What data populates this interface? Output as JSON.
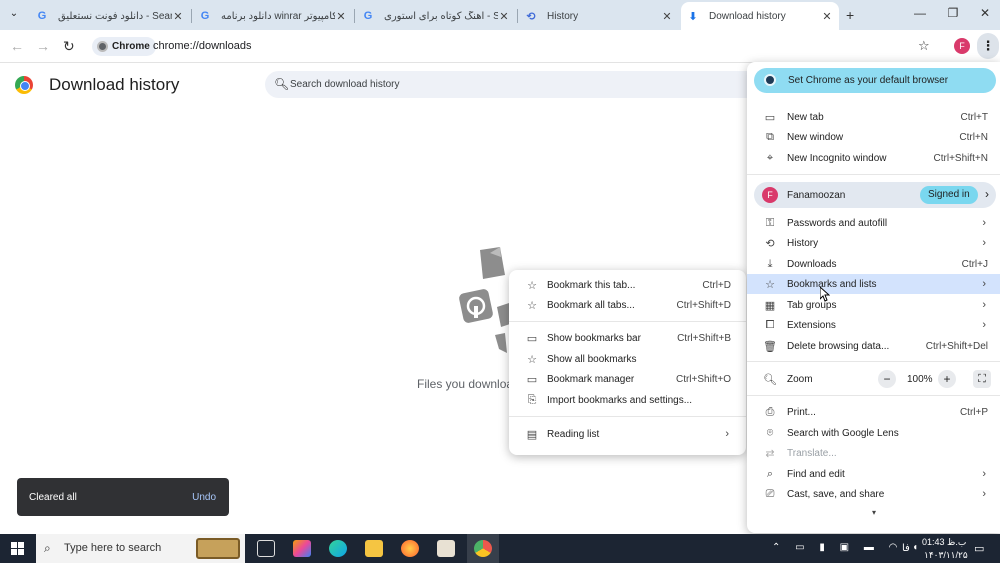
{
  "tabs": [
    {
      "title": "دانلود فونت نستعلیق - Search",
      "icon": "google-icon",
      "active": false
    },
    {
      "title": "دانلود برنامه winrar کامپیوتر -",
      "icon": "google-icon",
      "active": false
    },
    {
      "title": "آهنگ کوتاه برای استوری - Search",
      "icon": "google-icon",
      "active": false
    },
    {
      "title": "History",
      "icon": "history-icon",
      "active": false
    },
    {
      "title": "Download history",
      "icon": "download-icon",
      "active": true
    }
  ],
  "toolbar": {
    "site_chip": "Chrome",
    "url": "chrome://downloads",
    "profile_initial": "F"
  },
  "page": {
    "title": "Download history",
    "search_placeholder": "Search download history",
    "empty_text": "Files you download appear here"
  },
  "toast": {
    "message": "Cleared all",
    "action": "Undo"
  },
  "main_menu": {
    "banner": "Set Chrome as your default browser",
    "group1": [
      {
        "label": "New tab",
        "shortcut": "Ctrl+T",
        "icon": "new-tab-icon"
      },
      {
        "label": "New window",
        "shortcut": "Ctrl+N",
        "icon": "new-window-icon"
      },
      {
        "label": "New Incognito window",
        "shortcut": "Ctrl+Shift+N",
        "icon": "incognito-icon"
      }
    ],
    "profile": {
      "name": "Fanamoozan",
      "initial": "F",
      "status": "Signed in"
    },
    "group2": [
      {
        "label": "Passwords and autofill",
        "shortcut": "",
        "arrow": true,
        "icon": "key-icon"
      },
      {
        "label": "History",
        "shortcut": "",
        "arrow": true,
        "icon": "history-icon"
      },
      {
        "label": "Downloads",
        "shortcut": "Ctrl+J",
        "arrow": false,
        "icon": "download-icon"
      },
      {
        "label": "Bookmarks and lists",
        "shortcut": "",
        "arrow": true,
        "icon": "star-icon"
      },
      {
        "label": "Tab groups",
        "shortcut": "",
        "arrow": true,
        "icon": "tab-groups-icon"
      },
      {
        "label": "Extensions",
        "shortcut": "",
        "arrow": true,
        "icon": "puzzle-icon"
      },
      {
        "label": "Delete browsing data...",
        "shortcut": "Ctrl+Shift+Del",
        "arrow": false,
        "icon": "trash-icon"
      }
    ],
    "zoom": {
      "label": "Zoom",
      "minus": "−",
      "value": "100%",
      "plus": "+"
    },
    "group3": [
      {
        "label": "Print...",
        "shortcut": "Ctrl+P",
        "arrow": false,
        "icon": "print-icon",
        "disabled": false
      },
      {
        "label": "Search with Google Lens",
        "shortcut": "",
        "arrow": false,
        "icon": "lens-icon",
        "disabled": false
      },
      {
        "label": "Translate...",
        "shortcut": "",
        "arrow": false,
        "icon": "translate-icon",
        "disabled": true
      },
      {
        "label": "Find and edit",
        "shortcut": "",
        "arrow": true,
        "icon": "find-icon",
        "disabled": false
      },
      {
        "label": "Cast, save, and share",
        "shortcut": "",
        "arrow": true,
        "icon": "cast-icon",
        "disabled": false
      }
    ]
  },
  "submenu": {
    "group1": [
      {
        "label": "Bookmark this tab...",
        "shortcut": "Ctrl+D",
        "icon": "star-icon"
      },
      {
        "label": "Bookmark all tabs...",
        "shortcut": "Ctrl+Shift+D",
        "icon": "star-icon"
      }
    ],
    "group2": [
      {
        "label": "Show bookmarks bar",
        "shortcut": "Ctrl+Shift+B",
        "icon": "bookmarks-bar-icon"
      },
      {
        "label": "Show all bookmarks",
        "shortcut": "",
        "icon": "star-icon"
      },
      {
        "label": "Bookmark manager",
        "shortcut": "Ctrl+Shift+O",
        "icon": "bookmark-manager-icon"
      },
      {
        "label": "Import bookmarks and settings...",
        "shortcut": "",
        "icon": "import-icon"
      }
    ],
    "group3": [
      {
        "label": "Reading list",
        "shortcut": "",
        "icon": "reading-list-icon",
        "arrow": true
      }
    ]
  },
  "taskbar": {
    "search_placeholder": "Type here to search",
    "time": "01:43 ب.ظ",
    "date": "۱۴۰۳/۱۱/۲۵",
    "lang": "فا"
  },
  "colors": {
    "accent": "#0b57d0",
    "banner": "#8fdcf2",
    "highlight": "#d3e3fd",
    "signed_in_badge": "#79d7ef"
  }
}
